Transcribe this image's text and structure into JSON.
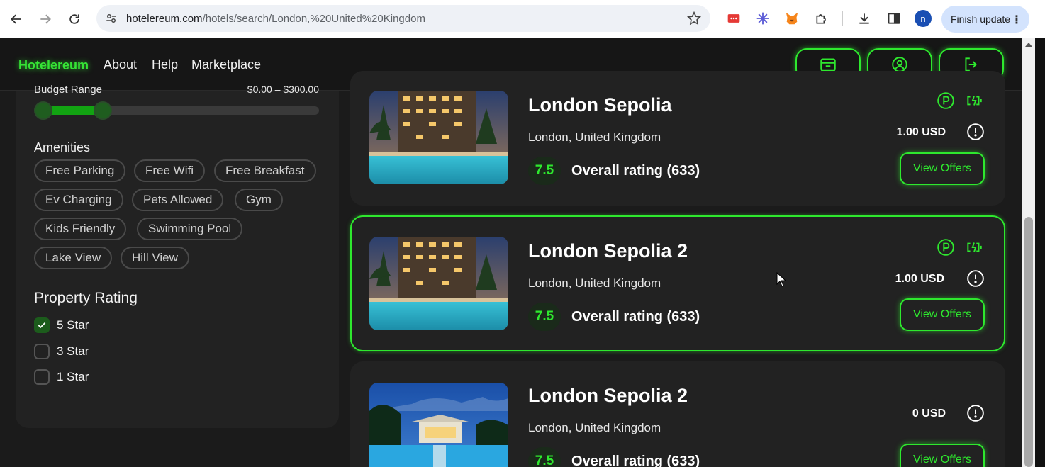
{
  "browser": {
    "url_host": "hotelereum.com",
    "url_path": "/hotels/search/London,%20United%20Kingdom",
    "finish_update_label": "Finish update",
    "profile_initial": "n",
    "icons": [
      "back-icon",
      "forward-icon",
      "reload-icon",
      "site-info-icon",
      "star-icon",
      "extension-red-icon",
      "extension-snowflake-icon",
      "metamask-fox-icon",
      "puzzle-extensions-icon",
      "download-icon",
      "sidepanel-icon",
      "menu-dots-icon"
    ]
  },
  "header": {
    "logo": "Hotelereum",
    "nav": [
      "About",
      "Help",
      "Marketplace"
    ],
    "buttons": [
      "wallet-icon",
      "profile-icon",
      "logout-icon"
    ],
    "accent_color": "#2ee82e"
  },
  "filters": {
    "budget_label": "Budget Range",
    "budget_value": "$0.00 – $300.00",
    "budget_fill_fraction": 0.24,
    "amenities_title": "Amenities",
    "amenities": [
      "Free Parking",
      "Free Wifi",
      "Free Breakfast",
      "Ev Charging",
      "Pets Allowed",
      "Gym",
      "Kids Friendly",
      "Swimming Pool",
      "Lake View",
      "Hill View"
    ],
    "rating_title": "Property Rating",
    "ratings": [
      {
        "label": "5 Star",
        "checked": true
      },
      {
        "label": "3 Star",
        "checked": false
      },
      {
        "label": "1 Star",
        "checked": false
      }
    ]
  },
  "hotels": [
    {
      "name": "London Sepolia",
      "location": "London, United Kingdom",
      "score": "7.5",
      "rating_text": "Overall rating (633)",
      "price": "1.00 USD",
      "offers_label": "View Offers",
      "amenity_icons": [
        "parking-icon",
        "ev-charging-icon"
      ]
    },
    {
      "name": "London Sepolia 2",
      "location": "London, United Kingdom",
      "score": "7.5",
      "rating_text": "Overall rating (633)",
      "price": "1.00 USD",
      "offers_label": "View Offers",
      "amenity_icons": [
        "parking-icon",
        "ev-charging-icon"
      ]
    },
    {
      "name": "London Sepolia 2",
      "location": "London, United Kingdom",
      "score": "7.5",
      "rating_text": "Overall rating (633)",
      "price": "0 USD",
      "offers_label": "View Offers",
      "amenity_icons": []
    }
  ]
}
